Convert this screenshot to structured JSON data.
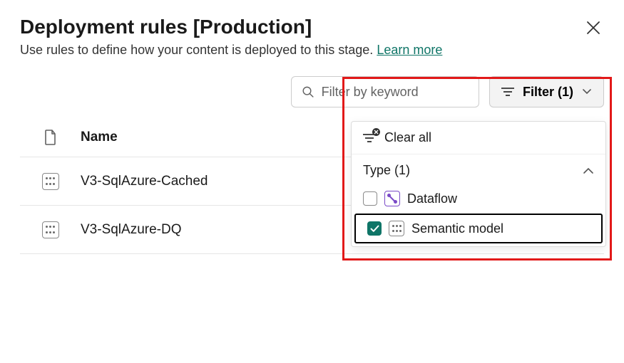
{
  "header": {
    "title": "Deployment rules [Production]",
    "subtitle": "Use rules to define how your content is deployed to this stage.",
    "learn_more": "Learn more"
  },
  "toolbar": {
    "search_placeholder": "Filter by keyword",
    "filter_label": "Filter (1)"
  },
  "table": {
    "headers": {
      "name": "Name"
    },
    "rows": [
      {
        "name": "V3-SqlAzure-Cached",
        "type": "semantic-model"
      },
      {
        "name": "V3-SqlAzure-DQ",
        "type": "semantic-model"
      }
    ]
  },
  "filter_panel": {
    "clear_all": "Clear all",
    "section_label": "Type (1)",
    "options": [
      {
        "label": "Dataflow",
        "checked": false,
        "icon": "dataflow"
      },
      {
        "label": "Semantic model",
        "checked": true,
        "icon": "semantic-model"
      }
    ]
  }
}
